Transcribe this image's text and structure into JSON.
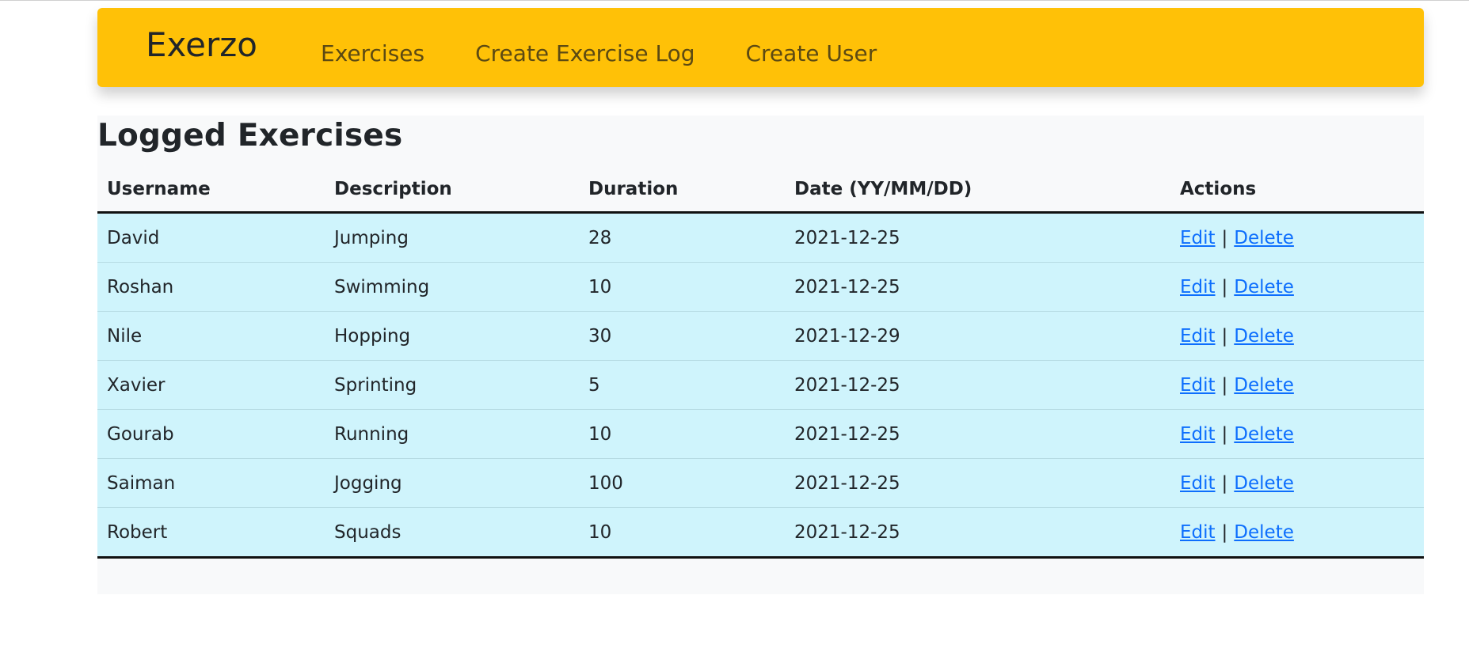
{
  "navbar": {
    "brand": "Exerzo",
    "links": [
      "Exercises",
      "Create Exercise Log",
      "Create User"
    ],
    "bg_color": "#ffc107"
  },
  "page": {
    "title": "Logged Exercises"
  },
  "table": {
    "headers": [
      "Username",
      "Description",
      "Duration",
      "Date (YY/MM/DD)",
      "Actions"
    ],
    "rows": [
      {
        "username": "David",
        "description": "Jumping",
        "duration": "28",
        "date": "2021-12-25"
      },
      {
        "username": "Roshan",
        "description": "Swimming",
        "duration": "10",
        "date": "2021-12-25"
      },
      {
        "username": "Nile",
        "description": "Hopping",
        "duration": "30",
        "date": "2021-12-29"
      },
      {
        "username": "Xavier",
        "description": "Sprinting",
        "duration": "5",
        "date": "2021-12-25"
      },
      {
        "username": "Gourab",
        "description": "Running",
        "duration": "10",
        "date": "2021-12-25"
      },
      {
        "username": "Saiman",
        "description": "Jogging",
        "duration": "100",
        "date": "2021-12-25"
      },
      {
        "username": "Robert",
        "description": "Squads",
        "duration": "10",
        "date": "2021-12-25"
      }
    ],
    "actions": {
      "edit": "Edit",
      "separator": "|",
      "delete": "Delete"
    },
    "row_color": "#cff4fc",
    "link_color": "#0d6efd"
  }
}
